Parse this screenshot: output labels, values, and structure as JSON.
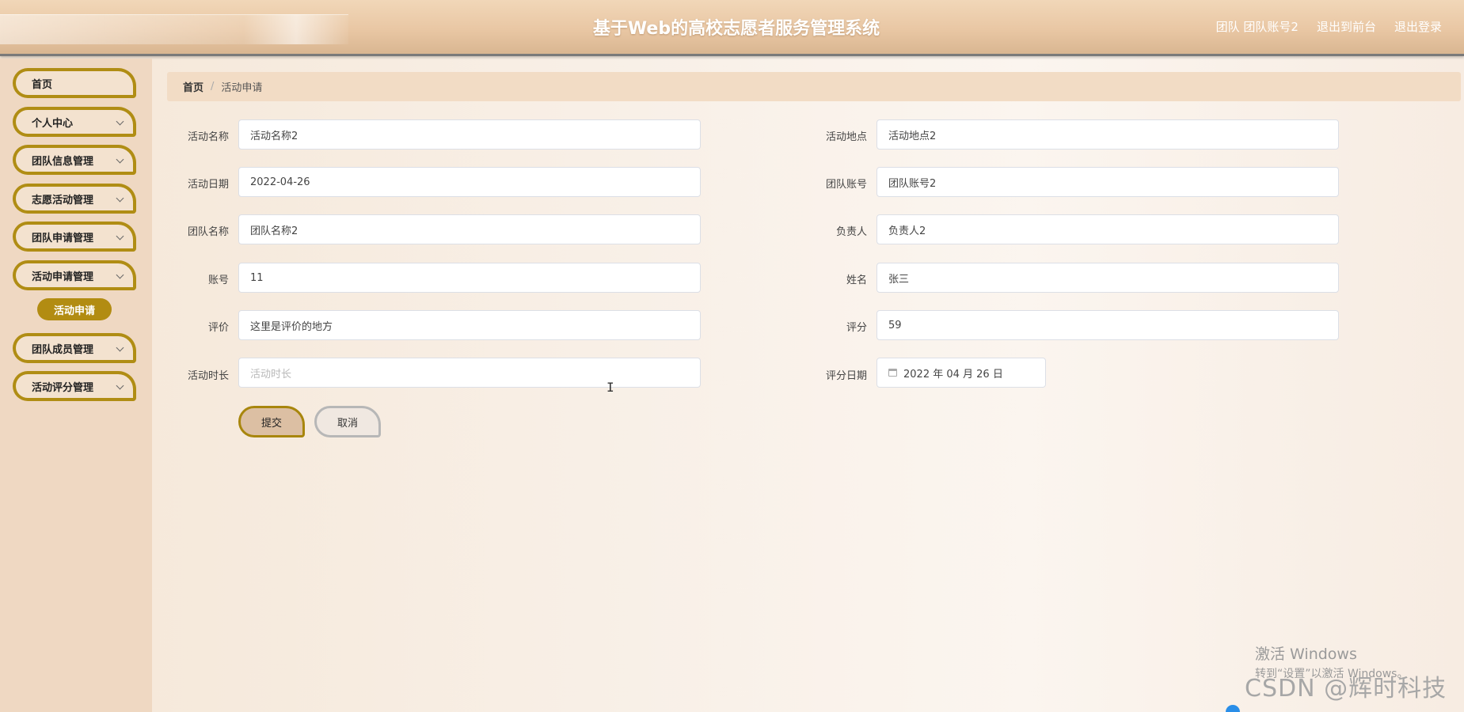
{
  "header": {
    "title": "基于Web的高校志愿者服务管理系统",
    "user_label": "团队 团队账号2",
    "exit_front_label": "退出到前台",
    "logout_label": "退出登录"
  },
  "sidebar": {
    "items": [
      {
        "label": "首页",
        "has_submenu": false
      },
      {
        "label": "个人中心",
        "has_submenu": true
      },
      {
        "label": "团队信息管理",
        "has_submenu": true
      },
      {
        "label": "志愿活动管理",
        "has_submenu": true
      },
      {
        "label": "团队申请管理",
        "has_submenu": true
      },
      {
        "label": "活动申请管理",
        "has_submenu": true
      },
      {
        "label": "团队成员管理",
        "has_submenu": true
      },
      {
        "label": "活动评分管理",
        "has_submenu": true
      }
    ],
    "active_subitem": "活动申请"
  },
  "breadcrumb": {
    "home": "首页",
    "separator": "/",
    "current": "活动申请"
  },
  "form": {
    "activity_name": {
      "label": "活动名称",
      "value": "活动名称2"
    },
    "activity_location": {
      "label": "活动地点",
      "value": "活动地点2"
    },
    "activity_date": {
      "label": "活动日期",
      "value": "2022-04-26"
    },
    "team_account": {
      "label": "团队账号",
      "value": "团队账号2"
    },
    "team_name": {
      "label": "团队名称",
      "value": "团队名称2"
    },
    "leader": {
      "label": "负责人",
      "value": "负责人2"
    },
    "account": {
      "label": "账号",
      "value": "11"
    },
    "name": {
      "label": "姓名",
      "value": "张三"
    },
    "review": {
      "label": "评价",
      "value": "这里是评价的地方"
    },
    "score": {
      "label": "评分",
      "value": "59"
    },
    "duration": {
      "label": "活动时长",
      "value": "",
      "placeholder": "活动时长"
    },
    "score_date": {
      "label": "评分日期",
      "value": "2022 年 04 月 26 日"
    },
    "submit_label": "提交",
    "cancel_label": "取消"
  },
  "watermark": {
    "windows_line1": "激活 Windows",
    "windows_line2": "转到“设置”以激活 Windows。",
    "csdn": "CSDN @辉时科技"
  },
  "colors": {
    "accent_gold": "#b08d14",
    "header_bg": "#e9c7a4",
    "sidebar_bg": "#efd8c2"
  }
}
